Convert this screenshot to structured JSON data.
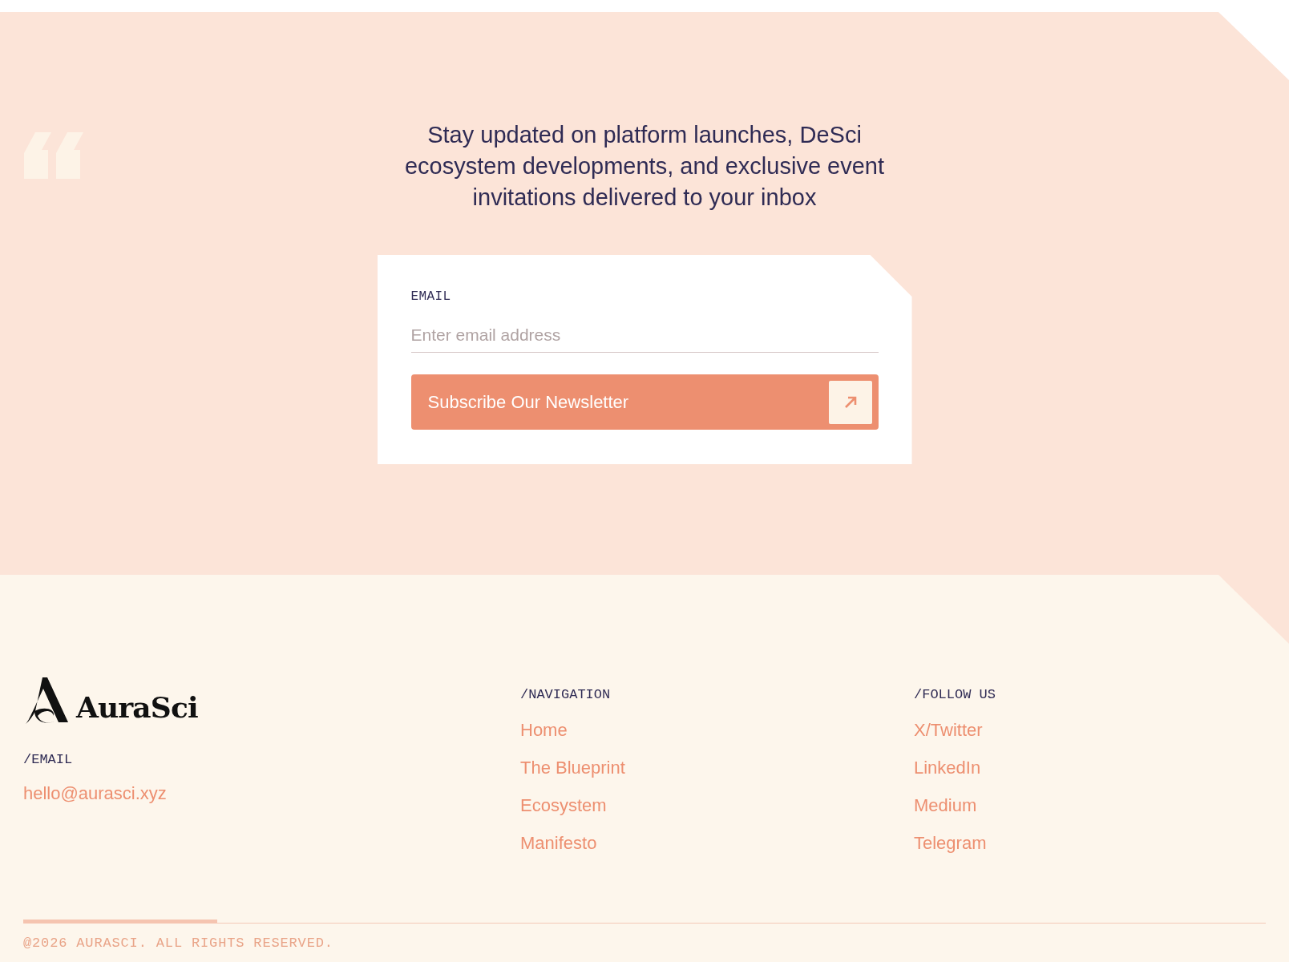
{
  "newsletter": {
    "heading": "Stay updated on platform launches, DeSci ecosystem developments, and exclusive event invitations delivered to your inbox",
    "form": {
      "label": "EMAIL",
      "placeholder": "Enter email address",
      "button": "Subscribe Our Newsletter"
    }
  },
  "footer": {
    "logo_text": "AuraSci",
    "email_label": "/EMAIL",
    "email": "hello@aurasci.xyz",
    "columns": [
      {
        "title": "/NAVIGATION",
        "links": [
          "Home",
          "The Blueprint",
          "Ecosystem",
          "Manifesto"
        ]
      },
      {
        "title": "/FOLLOW US",
        "links": [
          "X/Twitter",
          "LinkedIn",
          "Medium",
          "Telegram"
        ]
      }
    ],
    "copyright": "@2026 AURASCI. ALL RIGHTS RESERVED."
  }
}
